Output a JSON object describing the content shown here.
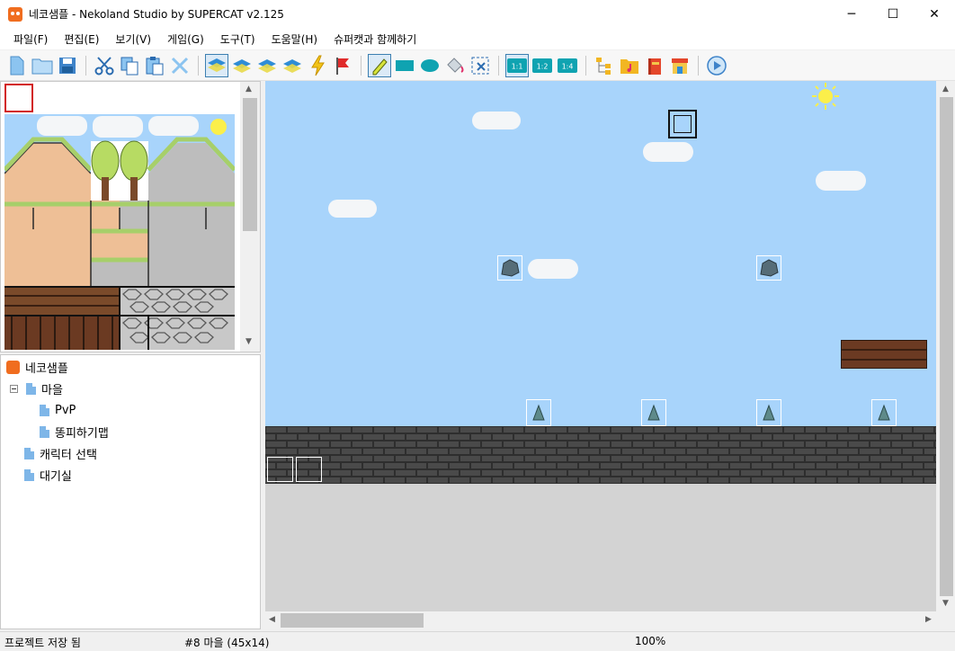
{
  "window": {
    "title": "네코샘플 - Nekoland Studio by SUPERCAT v2.125",
    "icon": "neko-app-icon",
    "minimize": "─",
    "maximize": "☐",
    "close": "✕"
  },
  "menu": [
    "파일(F)",
    "편집(E)",
    "보기(V)",
    "게임(G)",
    "도구(T)",
    "도움말(H)",
    "슈퍼캣과 함께하기"
  ],
  "toolbar": {
    "groups": [
      [
        "new-file-icon",
        "open-folder-icon",
        "save-icon"
      ],
      [
        "cut-icon",
        "copy-icon",
        "paste-icon",
        "delete-icon"
      ],
      [
        "layer-1-icon",
        "layer-2-icon",
        "layer-3-icon",
        "layer-4-icon",
        "event-icon",
        "flag-icon"
      ],
      [
        "pencil-icon",
        "rectangle-icon",
        "ellipse-icon",
        "fill-bucket-icon",
        "select-icon"
      ],
      [
        "zoom-1-1-icon",
        "zoom-1-2-icon",
        "zoom-1-4-icon"
      ],
      [
        "tree-icon",
        "music-folder-icon",
        "books-icon",
        "shop-icon"
      ],
      [
        "play-icon"
      ]
    ],
    "zoom_labels": [
      "1:1",
      "1:2",
      "1:4"
    ]
  },
  "tree": {
    "root": "네코샘플",
    "items": [
      {
        "label": "마을",
        "level": 1,
        "expanded": true
      },
      {
        "label": "PvP",
        "level": 2
      },
      {
        "label": "똥피하기맵",
        "level": 2
      },
      {
        "label": "캐릭터 선택",
        "level": 1
      },
      {
        "label": "대기실",
        "level": 1
      }
    ]
  },
  "status": {
    "saved": "프로젝트 저장 됨",
    "map_info": "#8 마을 (45x14)",
    "zoom": "100%"
  },
  "colors": {
    "sky": "#a8d4fb",
    "brick": "#3f3f3f",
    "selection_red": "#d21f1f",
    "accent": "#3c7fb1"
  }
}
